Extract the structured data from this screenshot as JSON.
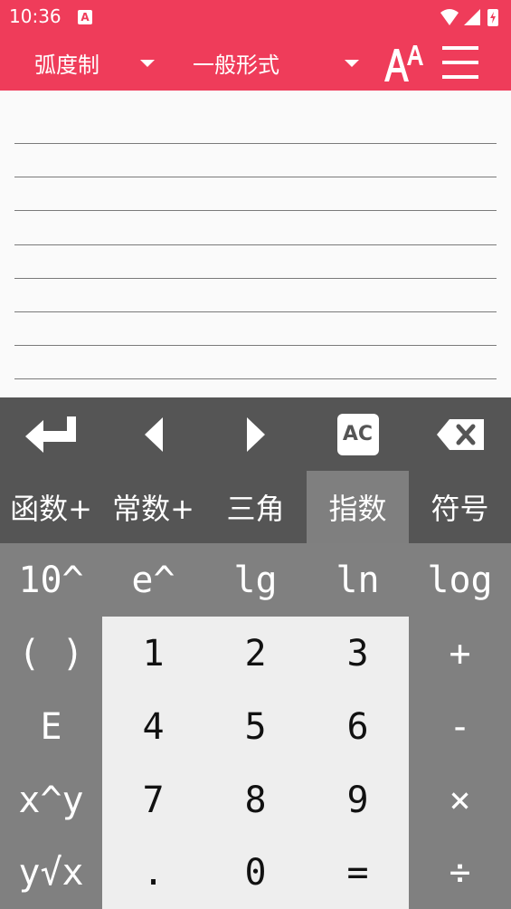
{
  "status_bar": {
    "time": "10:36",
    "notification_icon": "a-notification-icon"
  },
  "app_bar": {
    "angle_mode": "弧度制",
    "output_format": "一般形式",
    "font_size_icon": "font-size-icon",
    "menu_icon": "hamburger-menu-icon",
    "color": "#ef3c5a"
  },
  "display": {
    "lines": [
      "",
      "",
      "",
      "",
      "",
      "",
      "",
      ""
    ]
  },
  "toolbar": {
    "enter_icon": "enter-icon",
    "left_icon": "cursor-left-icon",
    "right_icon": "cursor-right-icon",
    "clear_label": "AC",
    "backspace_icon": "backspace-icon"
  },
  "tabs": [
    {
      "label": "函数+",
      "active": false
    },
    {
      "label": "常数+",
      "active": false
    },
    {
      "label": "三角",
      "active": false
    },
    {
      "label": "指数",
      "active": true
    },
    {
      "label": "符号",
      "active": false
    }
  ],
  "keypad": {
    "row1": [
      "10^",
      "e^",
      "lg",
      "ln",
      "log"
    ],
    "row2": [
      "( )",
      "1",
      "2",
      "3",
      "+"
    ],
    "row3": [
      "E",
      "4",
      "5",
      "6",
      "-"
    ],
    "row4": [
      "x^y",
      "7",
      "8",
      "9",
      "×"
    ],
    "row5": [
      "y√x",
      ".",
      "0",
      "=",
      "÷"
    ]
  }
}
